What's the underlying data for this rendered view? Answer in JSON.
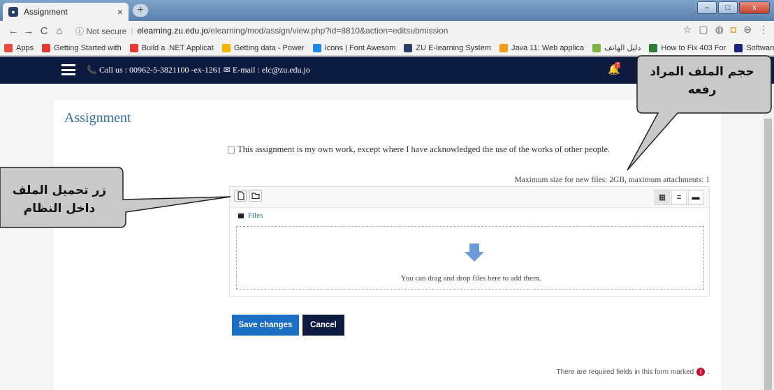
{
  "browser": {
    "tab_title": "Assignment",
    "tab_close": "×",
    "new_tab": "+",
    "window_controls": [
      "–",
      "□",
      "x"
    ],
    "nav_back": "←",
    "nav_forward": "→",
    "nav_reload": "C",
    "nav_home": "⌂",
    "security_label": "ⓘ Not secure",
    "url_host": "elearning.zu.edu.jo",
    "url_path": "/elearning/mod/assign/view.php?id=8810&action=editsubmission",
    "bookmarks": [
      {
        "label": "Apps",
        "color": "#e74c3c"
      },
      {
        "label": "Getting Started with",
        "color": "#e53935"
      },
      {
        "label": "Build a .NET Applicat",
        "color": "#e53935"
      },
      {
        "label": "Getting data - Power",
        "color": "#f4b400"
      },
      {
        "label": "Icons | Font Awesom",
        "color": "#1e88e5"
      },
      {
        "label": "ZU E-learning System",
        "color": "#2c3e66"
      },
      {
        "label": "Java 11: Web applica",
        "color": "#f39c12"
      },
      {
        "label": "دليل الهاتف",
        "color": "#7cb342"
      },
      {
        "label": "How to Fix 403 For",
        "color": "#2e7d32"
      },
      {
        "label": "Software Design Gu",
        "color": "#1a237e"
      }
    ]
  },
  "header": {
    "contact": "📞 Call us : 00962-5-3821100 -ex-1261  ✉ E-mail : elc@zu.edu.jo",
    "notification_count": "7"
  },
  "main": {
    "title": "Assignment",
    "statement": "This assignment is my own work, except where I have acknowledged the use of the works of other people.",
    "max_size": "Maximum size for new files: 2GB, maximum attachments: 1",
    "files_label": "Files",
    "drop_text": "You can drag and drop files here to add them.",
    "save_label": "Save changes",
    "cancel_label": "Cancel",
    "required_text": "There are required fields in this form marked",
    "required_icon": "!",
    "view_icons": [
      "▦",
      "≡",
      "▬"
    ]
  },
  "callouts": {
    "file_size": "حجم الملف المراد رفعه",
    "upload_button": "زر تحميل الملف داخل النظام"
  },
  "colors": {
    "header_bg": "#0e1b40",
    "link": "#2f6fa8",
    "save_bg": "#1a6fc4",
    "arrow": "#6c9bd9"
  }
}
